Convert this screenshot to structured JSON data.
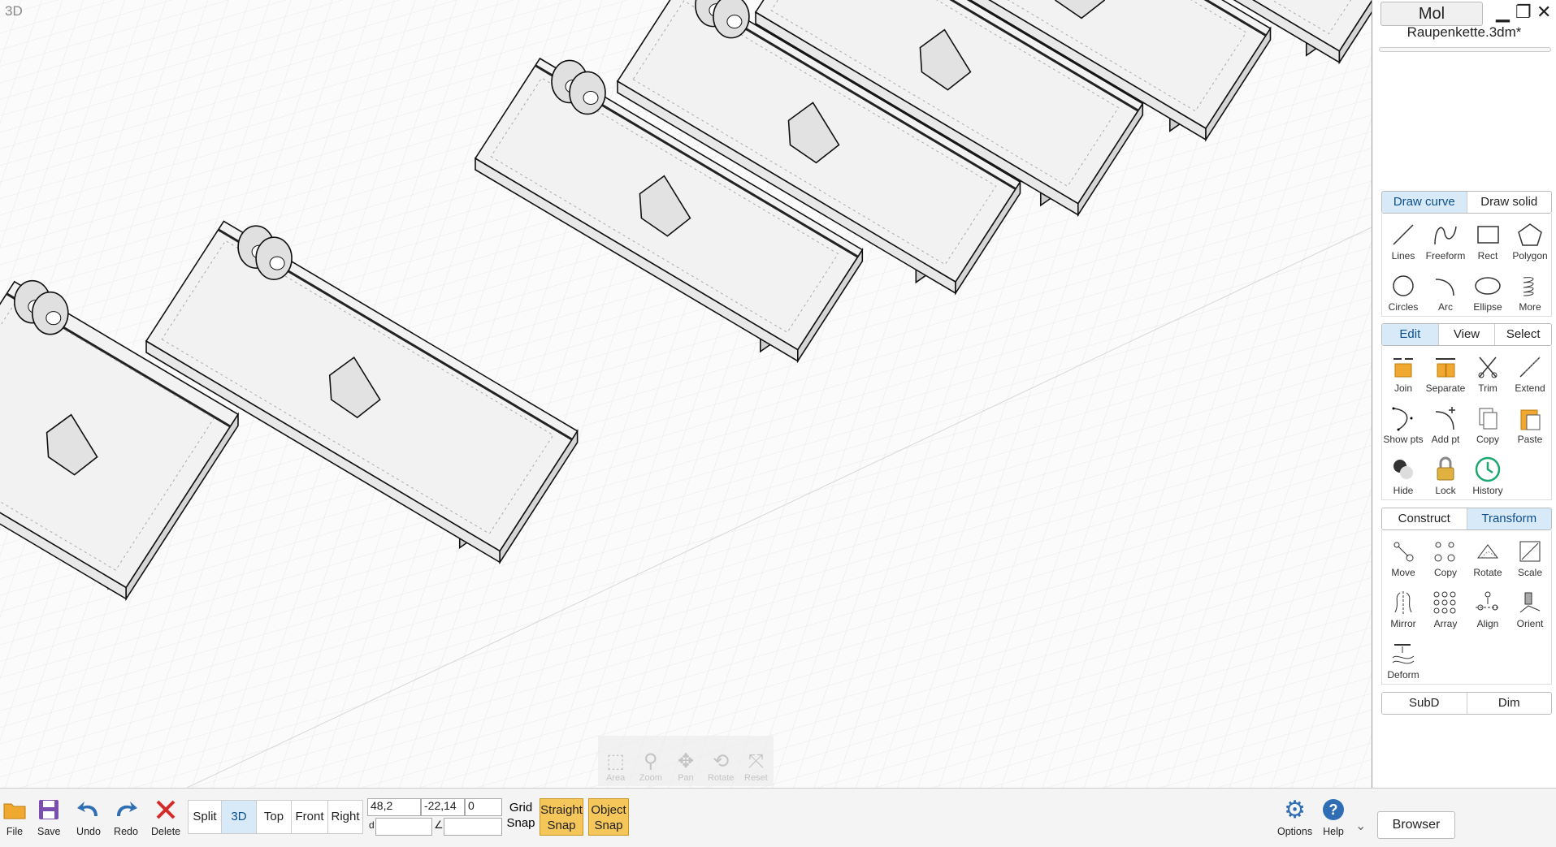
{
  "viewport": {
    "label": "3D"
  },
  "nav_tools": [
    {
      "label": "Area",
      "icon": "area-zoom-icon",
      "glyph": "⬚"
    },
    {
      "label": "Zoom",
      "icon": "zoom-icon",
      "glyph": "⚲"
    },
    {
      "label": "Pan",
      "icon": "pan-icon",
      "glyph": "✥"
    },
    {
      "label": "Rotate",
      "icon": "rotate-icon",
      "glyph": "⟲"
    },
    {
      "label": "Reset",
      "icon": "reset-icon",
      "glyph": "⤧"
    }
  ],
  "app": {
    "name": "Mol",
    "file": "Raupenkette.3dm*"
  },
  "draw": {
    "tabs": [
      "Draw curve",
      "Draw solid"
    ],
    "tools": [
      "Lines",
      "Freeform",
      "Rect",
      "Polygon",
      "Circles",
      "Arc",
      "Ellipse",
      "More"
    ]
  },
  "edit": {
    "tabs": [
      "Edit",
      "View",
      "Select"
    ],
    "tools": [
      "Join",
      "Separate",
      "Trim",
      "Extend",
      "Show pts",
      "Add pt",
      "Copy",
      "Paste",
      "Hide",
      "Lock",
      "History"
    ]
  },
  "transform": {
    "tabs": [
      "Construct",
      "Transform"
    ],
    "tools": [
      "Move",
      "Copy",
      "Rotate",
      "Scale",
      "Mirror",
      "Array",
      "Align",
      "Orient",
      "Deform"
    ]
  },
  "extra_tabs": [
    "SubD",
    "Dim"
  ],
  "bottom": {
    "file": "File",
    "save": "Save",
    "undo": "Undo",
    "redo": "Redo",
    "delete": "Delete",
    "views": [
      "Split",
      "3D",
      "Top",
      "Front",
      "Right"
    ],
    "coords": {
      "x": "48,2",
      "y": "-22,14",
      "z": "0",
      "d": "d",
      "angle": "∠"
    },
    "grid_snap": [
      "Grid",
      "Snap"
    ],
    "straight_snap": [
      "Straight",
      "Snap"
    ],
    "object_snap": [
      "Object",
      "Snap"
    ],
    "options": "Options",
    "help": "Help",
    "browser": "Browser"
  },
  "colors": {
    "accent_tab": "#d8e9f8",
    "snap_active": "#f5c65a",
    "icon_blue": "#2f6eb5",
    "icon_orange": "#f0a830",
    "delete_red": "#d42a2a"
  }
}
